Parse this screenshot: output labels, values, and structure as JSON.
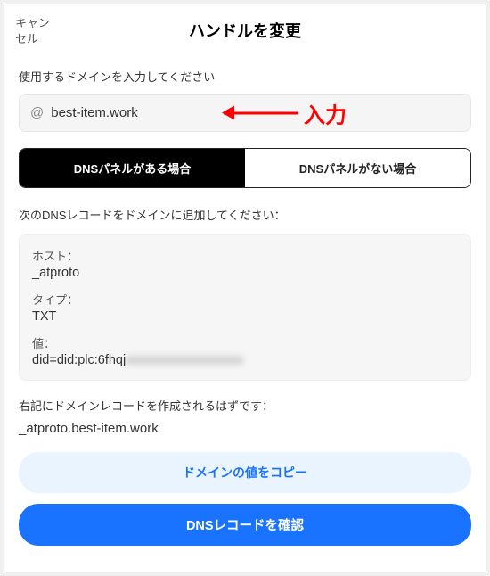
{
  "header": {
    "cancel": "キャンセル",
    "title": "ハンドルを変更"
  },
  "domain": {
    "label": "使用するドメインを入力してください",
    "at": "@",
    "value": "best-item.work",
    "annotation": "入力"
  },
  "tabs": {
    "has_panel": "DNSパネルがある場合",
    "no_panel": "DNSパネルがない場合"
  },
  "dns": {
    "instruction": "次のDNSレコードをドメインに追加してください：",
    "host_label": "ホスト：",
    "host_value": "_atproto",
    "type_label": "タイプ：",
    "type_value": "TXT",
    "value_label": "値：",
    "value_prefix": "did=did:plc:6fhqj",
    "value_blurred": "xxxxxxxxxxxxxxxxx"
  },
  "record": {
    "note": "右記にドメインレコードを作成されるはずです：",
    "name": "_atproto.best-item.work"
  },
  "buttons": {
    "copy": "ドメインの値をコピー",
    "verify": "DNSレコードを確認"
  }
}
